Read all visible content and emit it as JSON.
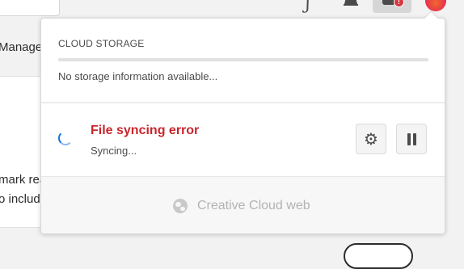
{
  "background": {
    "nav_label": "Manage",
    "text_lines": [
      "mark rea",
      "o includ"
    ]
  },
  "storage": {
    "title": "CLOUD STORAGE",
    "info": "No storage information available..."
  },
  "sync": {
    "title": "File syncing error",
    "status": "Syncing...",
    "settings_icon": "gear-icon",
    "pause_icon": "pause-icon"
  },
  "web": {
    "label": "Creative Cloud web",
    "icon": "globe-icon"
  },
  "colors": {
    "error": "#c9252d",
    "spinner": "#1473e6",
    "alert_badge": "#d7373f"
  }
}
